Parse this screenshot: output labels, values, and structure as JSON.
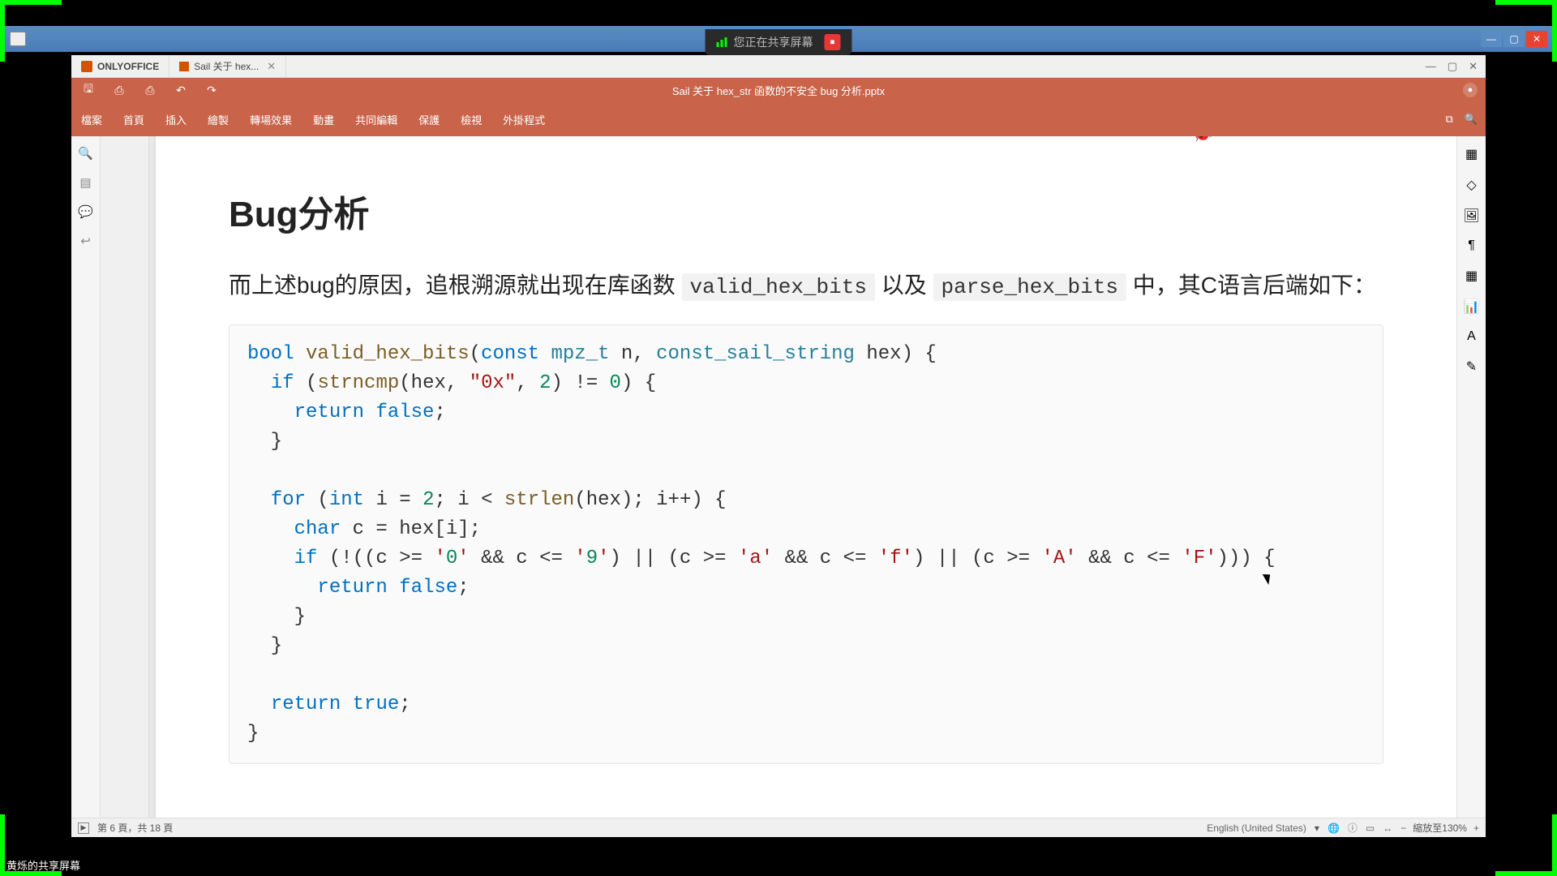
{
  "sharing": {
    "label": "您正在共享屏幕"
  },
  "footer_label": "黄烁的共享屏幕",
  "app": {
    "name": "ONLYOFFICE",
    "doc_tab": "Sail 关于 hex...",
    "title": "Sail 关于 hex_str 函数的不安全 bug 分析.pptx"
  },
  "menu": {
    "items": [
      "檔案",
      "首頁",
      "插入",
      "繪製",
      "轉場效果",
      "動畫",
      "共同編輯",
      "保護",
      "檢視",
      "外掛程式"
    ]
  },
  "left_rail": [
    "search-icon",
    "outline-icon",
    "comments-icon",
    "feedback-icon"
  ],
  "right_rail": [
    "slide-settings-icon",
    "shape-icon",
    "image-icon",
    "paragraph-icon",
    "table-icon",
    "chart-icon",
    "text-art-icon",
    "transition-icon"
  ],
  "slide": {
    "title": "Bug分析",
    "para_prefix_1": "而上述bug的原因，追根溯源就出现在库函数 ",
    "code1": "valid_hex_bits",
    "para_mid": " 以及 ",
    "code2": "parse_hex_bits",
    "para_suffix": " 中，其C语言后端如下：",
    "code_block": "bool valid_hex_bits(const mpz_t n, const_sail_string hex) {\n  if (strncmp(hex, \"0x\", 2) != 0) {\n    return false;\n  }\n\n  for (int i = 2; i < strlen(hex); i++) {\n    char c = hex[i];\n    if (!((c >= '0' && c <= '9') || (c >= 'a' && c <= 'f') || (c >= 'A' && c <= 'F'))) {\n      return false;\n    }\n  }\n\n  return true;\n}"
  },
  "status": {
    "page_info": "第 6 頁，共 18 頁",
    "lang": "English (United States)",
    "zoom_label": "縮放至130%"
  }
}
